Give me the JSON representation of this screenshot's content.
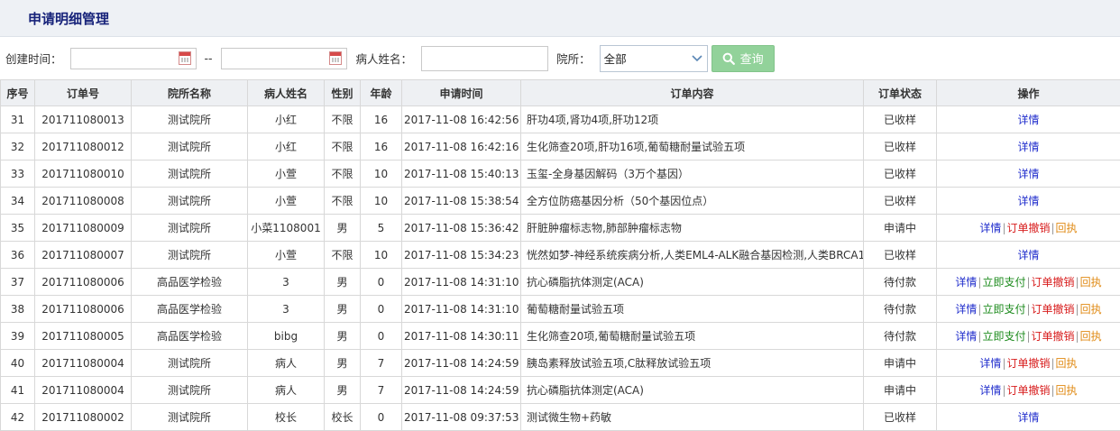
{
  "page": {
    "title": "申请明细管理"
  },
  "filters": {
    "created_label": "创建时间：",
    "range_sep": "--",
    "start_date": "",
    "end_date": "",
    "patient_label": "病人姓名：",
    "patient_value": "",
    "clinic_label": "院所：",
    "clinic_selected": "全部",
    "search_label": "查询"
  },
  "table": {
    "headers": [
      "序号",
      "订单号",
      "院所名称",
      "病人姓名",
      "性别",
      "年龄",
      "申请时间",
      "订单内容",
      "订单状态",
      "操作"
    ],
    "op_labels": {
      "detail": "详情",
      "pay": "立即支付",
      "cancel": "订单撤销",
      "receipt": "回执",
      "sep": "|"
    },
    "rows": [
      {
        "no": "31",
        "order": "201711080013",
        "clinic": "测试院所",
        "patient": "小红",
        "gender": "不限",
        "age": "16",
        "time": "2017-11-08 16:42:56",
        "content": "肝功4项,肾功4项,肝功12项",
        "status": "已收样",
        "ops": [
          "detail"
        ]
      },
      {
        "no": "32",
        "order": "201711080012",
        "clinic": "测试院所",
        "patient": "小红",
        "gender": "不限",
        "age": "16",
        "time": "2017-11-08 16:42:16",
        "content": "生化筛查20项,肝功16项,葡萄糖耐量试验五项",
        "status": "已收样",
        "ops": [
          "detail"
        ]
      },
      {
        "no": "33",
        "order": "201711080010",
        "clinic": "测试院所",
        "patient": "小萱",
        "gender": "不限",
        "age": "10",
        "time": "2017-11-08 15:40:13",
        "content": "玉玺-全身基因解码（3万个基因）",
        "status": "已收样",
        "ops": [
          "detail"
        ]
      },
      {
        "no": "34",
        "order": "201711080008",
        "clinic": "测试院所",
        "patient": "小萱",
        "gender": "不限",
        "age": "10",
        "time": "2017-11-08 15:38:54",
        "content": "全方位防癌基因分析（50个基因位点）",
        "status": "已收样",
        "ops": [
          "detail"
        ]
      },
      {
        "no": "35",
        "order": "201711080009",
        "clinic": "测试院所",
        "patient": "小菜1108001",
        "gender": "男",
        "age": "5",
        "time": "2017-11-08 15:36:42",
        "content": "肝脏肿瘤标志物,肺部肿瘤标志物",
        "status": "申请中",
        "ops": [
          "detail",
          "cancel",
          "receipt"
        ]
      },
      {
        "no": "36",
        "order": "201711080007",
        "clinic": "测试院所",
        "patient": "小萱",
        "gender": "不限",
        "age": "10",
        "time": "2017-11-08 15:34:23",
        "content": "恍然如梦-神经系统疾病分析,人类EML4-ALK融合基因检测,人类BRCA1/",
        "status": "已收样",
        "ops": [
          "detail"
        ]
      },
      {
        "no": "37",
        "order": "201711080006",
        "clinic": "高品医学检验",
        "patient": "3",
        "gender": "男",
        "age": "0",
        "time": "2017-11-08 14:31:10",
        "content": "抗心磷脂抗体测定(ACA)",
        "status": "待付款",
        "ops": [
          "detail",
          "pay",
          "cancel",
          "receipt"
        ]
      },
      {
        "no": "38",
        "order": "201711080006",
        "clinic": "高品医学检验",
        "patient": "3",
        "gender": "男",
        "age": "0",
        "time": "2017-11-08 14:31:10",
        "content": "葡萄糖耐量试验五项",
        "status": "待付款",
        "ops": [
          "detail",
          "pay",
          "cancel",
          "receipt"
        ]
      },
      {
        "no": "39",
        "order": "201711080005",
        "clinic": "高品医学检验",
        "patient": "bibg",
        "gender": "男",
        "age": "0",
        "time": "2017-11-08 14:30:11",
        "content": "生化筛查20项,葡萄糖耐量试验五项",
        "status": "待付款",
        "ops": [
          "detail",
          "pay",
          "cancel",
          "receipt"
        ]
      },
      {
        "no": "40",
        "order": "201711080004",
        "clinic": "测试院所",
        "patient": "病人",
        "gender": "男",
        "age": "7",
        "time": "2017-11-08 14:24:59",
        "content": "胰岛素释放试验五项,C肽释放试验五项",
        "status": "申请中",
        "ops": [
          "detail",
          "cancel",
          "receipt"
        ]
      },
      {
        "no": "41",
        "order": "201711080004",
        "clinic": "测试院所",
        "patient": "病人",
        "gender": "男",
        "age": "7",
        "time": "2017-11-08 14:24:59",
        "content": "抗心磷脂抗体测定(ACA)",
        "status": "申请中",
        "ops": [
          "detail",
          "cancel",
          "receipt"
        ]
      },
      {
        "no": "42",
        "order": "201711080002",
        "clinic": "测试院所",
        "patient": "校长",
        "gender": "校长",
        "age": "0",
        "time": "2017-11-08 09:37:53",
        "content": "测试微生物+药敏",
        "status": "已收样",
        "ops": [
          "detail"
        ]
      }
    ]
  },
  "colors": {
    "title": "#17237a",
    "detail": "#1f2ccc",
    "pay": "#1b8a1b",
    "cancel": "#d81e1e",
    "receipt": "#e08a14",
    "search_button": "#92d29a"
  },
  "icons": {
    "calendar": "calendar-icon",
    "dropdown": "chevron-down-icon",
    "search": "search-icon"
  }
}
